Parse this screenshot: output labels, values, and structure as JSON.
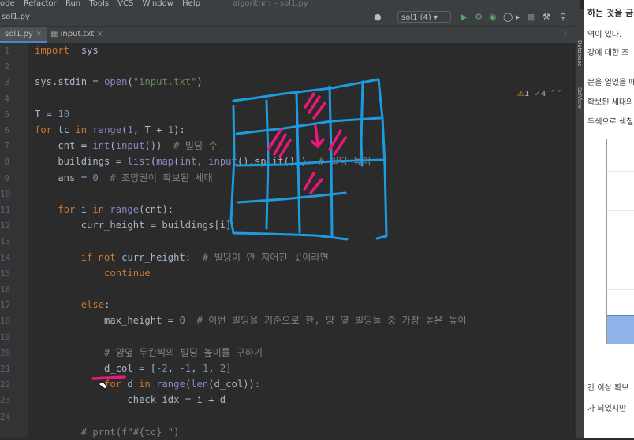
{
  "menubar": {
    "items": [
      "ode",
      "Refactor",
      "Run",
      "Tools",
      "VCS",
      "Window",
      "Help"
    ],
    "title": "algorithm – sol1.py"
  },
  "toolbar": {
    "project_file": "sol1.py",
    "run_config": "sol1 (4)"
  },
  "tabs": [
    {
      "label": "sol1.py",
      "active": true
    },
    {
      "label": "input.txt",
      "active": false
    }
  ],
  "inspections": {
    "warnings": "1",
    "ok": "4"
  },
  "sidebar_tabs": [
    "Database",
    "SciView"
  ],
  "editor": {
    "line_numbers": [
      "1",
      "2",
      "3",
      "4",
      "5",
      "6",
      "7",
      "8",
      "9",
      "10",
      "11",
      "12",
      "13",
      "14",
      "15",
      "16",
      "17",
      "18",
      "19",
      "20",
      "21",
      "22",
      "23",
      "24"
    ],
    "lines": [
      [
        [
          "kw",
          "import"
        ],
        [
          "",
          "  sys"
        ]
      ],
      [],
      [
        [
          "",
          "sys.stdin = "
        ],
        [
          "bi",
          "open"
        ],
        [
          "",
          "("
        ],
        [
          "st",
          "\"input.txt\""
        ],
        [
          "",
          ")"
        ]
      ],
      [],
      [
        [
          "",
          "T = "
        ],
        [
          "nm",
          "10"
        ]
      ],
      [
        [
          "kw",
          "for"
        ],
        [
          "",
          " tc "
        ],
        [
          "kw",
          "in"
        ],
        [
          "",
          " "
        ],
        [
          "bi",
          "range"
        ],
        [
          "",
          "("
        ],
        [
          "nm",
          "1"
        ],
        [
          "",
          ", T + "
        ],
        [
          "nm",
          "1"
        ],
        [
          "",
          "):"
        ]
      ],
      [
        [
          "",
          "    cnt = "
        ],
        [
          "bi",
          "int"
        ],
        [
          "",
          "("
        ],
        [
          "bi",
          "input"
        ],
        [
          "",
          "())  "
        ],
        [
          "cm",
          "# 빌딩 수"
        ]
      ],
      [
        [
          "",
          "    buildings = "
        ],
        [
          "bi",
          "list"
        ],
        [
          "",
          "("
        ],
        [
          "bi",
          "map"
        ],
        [
          "",
          "("
        ],
        [
          "bi",
          "int"
        ],
        [
          "",
          ", "
        ],
        [
          "bi",
          "input"
        ],
        [
          "",
          "().split()))  "
        ],
        [
          "cm",
          "# 빌딩 높이"
        ]
      ],
      [
        [
          "",
          "    ans = "
        ],
        [
          "nm",
          "0"
        ],
        [
          "",
          "  "
        ],
        [
          "cm",
          "# 조망권이 확보된 세대"
        ]
      ],
      [],
      [
        [
          "",
          "    "
        ],
        [
          "kw",
          "for"
        ],
        [
          "",
          " i "
        ],
        [
          "kw",
          "in"
        ],
        [
          "",
          " "
        ],
        [
          "bi",
          "range"
        ],
        [
          "",
          "(cnt):"
        ]
      ],
      [
        [
          "",
          "        curr_height = buildings[i]"
        ]
      ],
      [],
      [
        [
          "",
          "        "
        ],
        [
          "kw",
          "if not"
        ],
        [
          "",
          " curr_height:  "
        ],
        [
          "cm",
          "# 빌딩이 안 지어진 곳이라면"
        ]
      ],
      [
        [
          "",
          "            "
        ],
        [
          "kw",
          "continue"
        ]
      ],
      [],
      [
        [
          "",
          "        "
        ],
        [
          "kw",
          "else"
        ],
        [
          "",
          ":"
        ]
      ],
      [
        [
          "",
          "            max_height = "
        ],
        [
          "nm",
          "0"
        ],
        [
          "",
          "  "
        ],
        [
          "cm",
          "# 이번 빌딩을 기준으로 한, 양 옆 빌딩들 중 가장 높은 높이"
        ]
      ],
      [],
      [
        [
          "",
          "            "
        ],
        [
          "cm",
          "# 양옆 두칸씩의 빌딩 높이를 구하기"
        ]
      ],
      [
        [
          "",
          "            d_col = ["
        ],
        [
          "nm",
          "-2"
        ],
        [
          "",
          ", "
        ],
        [
          "nm",
          "-1"
        ],
        [
          "",
          ", "
        ],
        [
          "nm",
          "1"
        ],
        [
          "",
          ", "
        ],
        [
          "nm",
          "2"
        ],
        [
          "",
          "]"
        ]
      ],
      [
        [
          "",
          "            "
        ],
        [
          "kw",
          "for"
        ],
        [
          "",
          " d "
        ],
        [
          "kw",
          "in"
        ],
        [
          "",
          " "
        ],
        [
          "bi",
          "range"
        ],
        [
          "",
          "("
        ],
        [
          "bi",
          "len"
        ],
        [
          "",
          "(d_col)):"
        ]
      ],
      [
        [
          "",
          "                check_idx = i + d"
        ]
      ],
      [],
      [
        [
          "",
          "        "
        ],
        [
          "cm",
          "# prnt(f\"#{tc} \")"
        ]
      ]
    ]
  },
  "doc": {
    "lines": [
      "하는 것을 금지",
      "역이 있다.",
      "강에 대한 조",
      "문을 열었을 때",
      "확보된 세대의",
      "두색으로 색칠",
      "칸 이상 확보",
      "가 되었지만"
    ]
  }
}
